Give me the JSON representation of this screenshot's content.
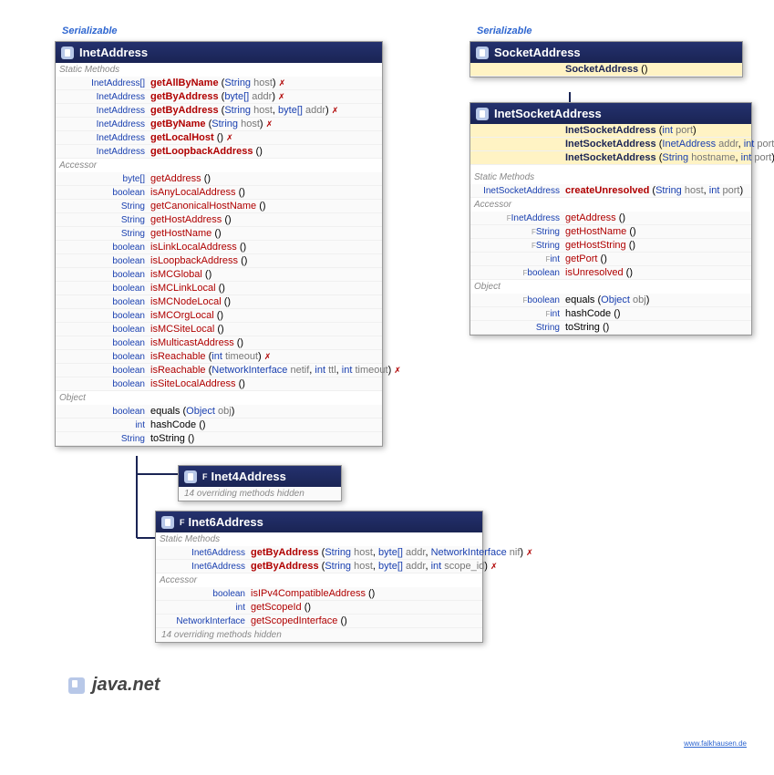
{
  "serializable": "Serializable",
  "package": "java.net",
  "footer": "www.falkhausen.de",
  "inet": {
    "title": "InetAddress",
    "sec_static": "Static Methods",
    "sec_accessor": "Accessor",
    "sec_object": "Object",
    "statics": [
      {
        "ret": "InetAddress[]",
        "name": "getAllByName",
        "params": "(String host)",
        "throws": true
      },
      {
        "ret": "InetAddress",
        "name": "getByAddress",
        "params": "(byte[] addr)",
        "throws": true
      },
      {
        "ret": "InetAddress",
        "name": "getByAddress",
        "params": "(String host, byte[] addr)",
        "throws": true
      },
      {
        "ret": "InetAddress",
        "name": "getByName",
        "params": "(String host)",
        "throws": true
      },
      {
        "ret": "InetAddress",
        "name": "getLocalHost",
        "params": "()",
        "throws": true
      },
      {
        "ret": "InetAddress",
        "name": "getLoopbackAddress",
        "params": "()"
      }
    ],
    "accessors": [
      {
        "ret": "byte[]",
        "name": "getAddress",
        "params": "()"
      },
      {
        "ret": "boolean",
        "name": "isAnyLocalAddress",
        "params": "()"
      },
      {
        "ret": "String",
        "name": "getCanonicalHostName",
        "params": "()"
      },
      {
        "ret": "String",
        "name": "getHostAddress",
        "params": "()"
      },
      {
        "ret": "String",
        "name": "getHostName",
        "params": "()"
      },
      {
        "ret": "boolean",
        "name": "isLinkLocalAddress",
        "params": "()"
      },
      {
        "ret": "boolean",
        "name": "isLoopbackAddress",
        "params": "()"
      },
      {
        "ret": "boolean",
        "name": "isMCGlobal",
        "params": "()"
      },
      {
        "ret": "boolean",
        "name": "isMCLinkLocal",
        "params": "()"
      },
      {
        "ret": "boolean",
        "name": "isMCNodeLocal",
        "params": "()"
      },
      {
        "ret": "boolean",
        "name": "isMCOrgLocal",
        "params": "()"
      },
      {
        "ret": "boolean",
        "name": "isMCSiteLocal",
        "params": "()"
      },
      {
        "ret": "boolean",
        "name": "isMulticastAddress",
        "params": "()"
      },
      {
        "ret": "boolean",
        "name": "isReachable",
        "params": "(int timeout)",
        "throws": true
      },
      {
        "ret": "boolean",
        "name": "isReachable",
        "params": "(NetworkInterface netif, int ttl, int timeout)",
        "throws": true
      },
      {
        "ret": "boolean",
        "name": "isSiteLocalAddress",
        "params": "()"
      }
    ],
    "objects": [
      {
        "ret": "boolean",
        "name": "equals",
        "params": "(Object obj)"
      },
      {
        "ret": "int",
        "name": "hashCode",
        "params": "()"
      },
      {
        "ret": "String",
        "name": "toString",
        "params": "()"
      }
    ]
  },
  "inet4": {
    "title": "Inet4Address",
    "overriding": "14 overriding methods hidden",
    "final": "F"
  },
  "inet6": {
    "title": "Inet6Address",
    "final": "F",
    "sec_static": "Static Methods",
    "sec_accessor": "Accessor",
    "statics": [
      {
        "ret": "Inet6Address",
        "name": "getByAddress",
        "params": "(String host, byte[] addr, NetworkInterface nif)",
        "throws": true
      },
      {
        "ret": "Inet6Address",
        "name": "getByAddress",
        "params": "(String host, byte[] addr, int scope_id)",
        "throws": true
      }
    ],
    "accessors": [
      {
        "ret": "boolean",
        "name": "isIPv4CompatibleAddress",
        "params": "()"
      },
      {
        "ret": "int",
        "name": "getScopeId",
        "params": "()"
      },
      {
        "ret": "NetworkInterface",
        "name": "getScopedInterface",
        "params": "()"
      }
    ],
    "overriding": "14 overriding methods hidden"
  },
  "socket": {
    "title": "SocketAddress",
    "constructors": [
      {
        "name": "SocketAddress",
        "params": "()"
      }
    ]
  },
  "inetsocket": {
    "title": "InetSocketAddress",
    "constructors": [
      {
        "name": "InetSocketAddress",
        "params": "(int port)"
      },
      {
        "name": "InetSocketAddress",
        "params": "(InetAddress addr, int port)"
      },
      {
        "name": "InetSocketAddress",
        "params": "(String hostname, int port)"
      }
    ],
    "sec_static": "Static Methods",
    "sec_accessor": "Accessor",
    "sec_object": "Object",
    "statics": [
      {
        "ret": "InetSocketAddress",
        "name": "createUnresolved",
        "params": "(String host, int port)"
      }
    ],
    "accessors": [
      {
        "fin": "F",
        "ret": "InetAddress",
        "name": "getAddress",
        "params": "()"
      },
      {
        "fin": "F",
        "ret": "String",
        "name": "getHostName",
        "params": "()"
      },
      {
        "fin": "F",
        "ret": "String",
        "name": "getHostString",
        "params": "()"
      },
      {
        "fin": "F",
        "ret": "int",
        "name": "getPort",
        "params": "()"
      },
      {
        "fin": "F",
        "ret": "boolean",
        "name": "isUnresolved",
        "params": "()"
      }
    ],
    "objects": [
      {
        "fin": "F",
        "ret": "boolean",
        "name": "equals",
        "params": "(Object obj)"
      },
      {
        "fin": "F",
        "ret": "int",
        "name": "hashCode",
        "params": "()"
      },
      {
        "ret": "String",
        "name": "toString",
        "params": "()"
      }
    ]
  }
}
